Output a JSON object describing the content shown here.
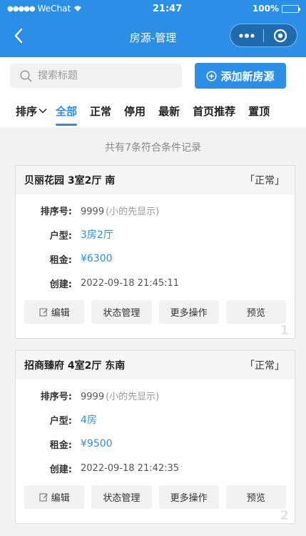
{
  "status_bar": {
    "carrier": "WeChat",
    "time": "21:47",
    "battery": "100%"
  },
  "nav": {
    "title": "房源-管理"
  },
  "search": {
    "placeholder": "搜索标题"
  },
  "add_button": {
    "label": "添加新房源"
  },
  "tabs": [
    {
      "label": "排序"
    },
    {
      "label": "全部"
    },
    {
      "label": "正常"
    },
    {
      "label": "停用"
    },
    {
      "label": "最新"
    },
    {
      "label": "首页推荐"
    },
    {
      "label": "置顶"
    }
  ],
  "count_text": "共有7条符合条件记录",
  "field_labels": {
    "sort": "排序号:",
    "layout": "户型:",
    "rent": "租金:",
    "created": "创建:"
  },
  "actions": {
    "edit": "编辑",
    "status": "状态管理",
    "more": "更多操作",
    "preview": "预览"
  },
  "listings": [
    {
      "title": "贝丽花园 3室2厅 南",
      "status": "「正常」",
      "sort_no": "9999",
      "sort_hint": "(小的先显示)",
      "layout": "3房2厅",
      "rent": "¥6300",
      "created": "2022-09-18 21:45:11",
      "index": "1"
    },
    {
      "title": "招商臻府 4室2厅 东南",
      "status": "「正常」",
      "sort_no": "9999",
      "sort_hint": "(小的先显示)",
      "layout": "4房",
      "rent": "¥9500",
      "created": "2022-09-18 21:42:35",
      "index": "2"
    }
  ]
}
